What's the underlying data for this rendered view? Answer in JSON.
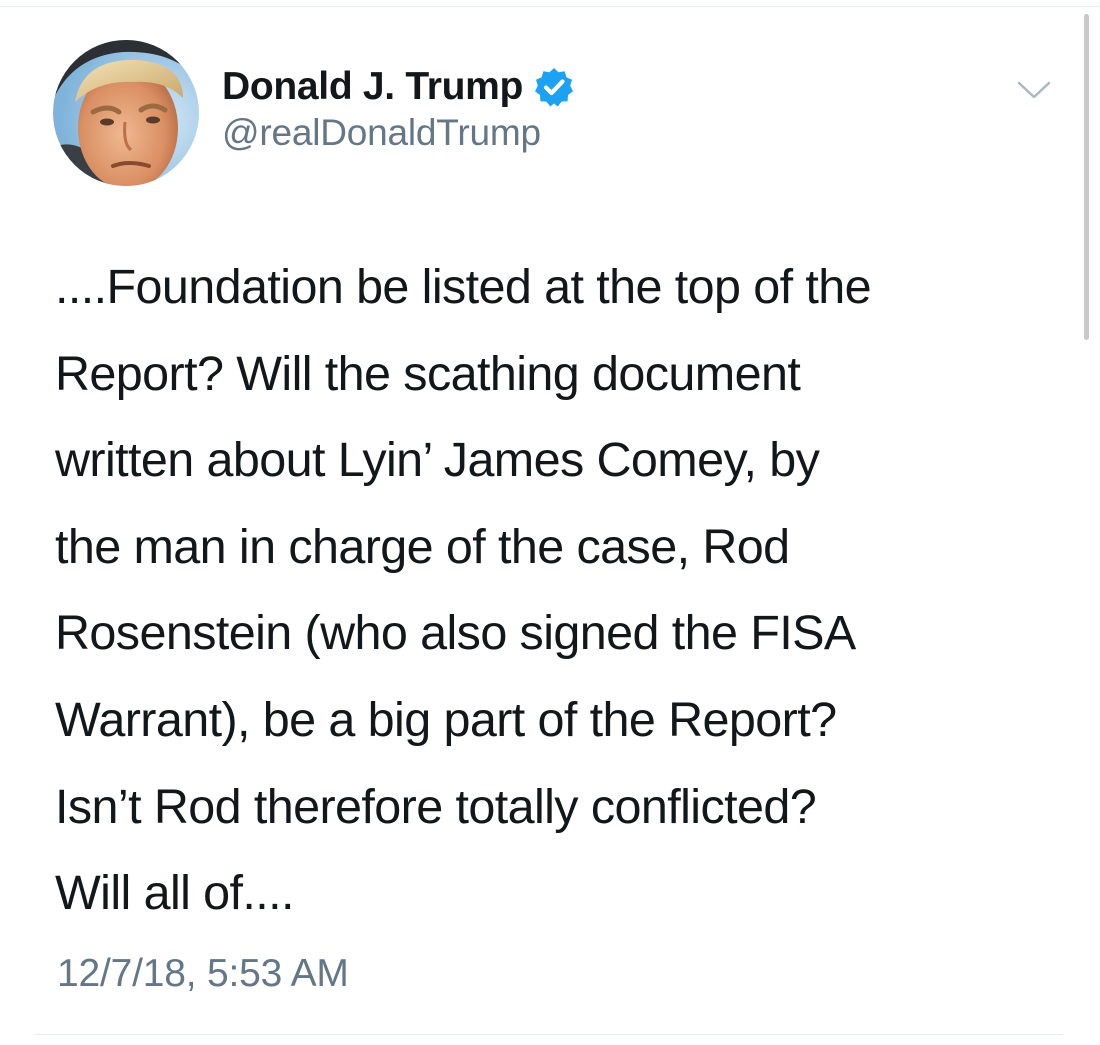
{
  "author": {
    "display_name": "Donald J. Trump",
    "handle": "@realDonaldTrump",
    "verified": true,
    "avatar_icon": "profile-photo"
  },
  "tweet": {
    "lines": [
      "....Foundation be listed at the top of the",
      "Report? Will the scathing document",
      "written about Lyin’ James Comey, by",
      "the man in charge of the case, Rod",
      "Rosenstein (who also signed the FISA",
      "Warrant), be a big part of the Report?",
      "Isn’t Rod therefore totally conflicted?",
      "Will all of...."
    ],
    "timestamp": "12/7/18, 5:53 AM"
  },
  "icons": {
    "verified": "verified-badge-icon",
    "menu": "chevron-down-icon"
  },
  "colors": {
    "text": "#14171a",
    "secondary_text": "#657786",
    "verified_blue": "#1da1f2",
    "divider": "#e6ecf0"
  }
}
